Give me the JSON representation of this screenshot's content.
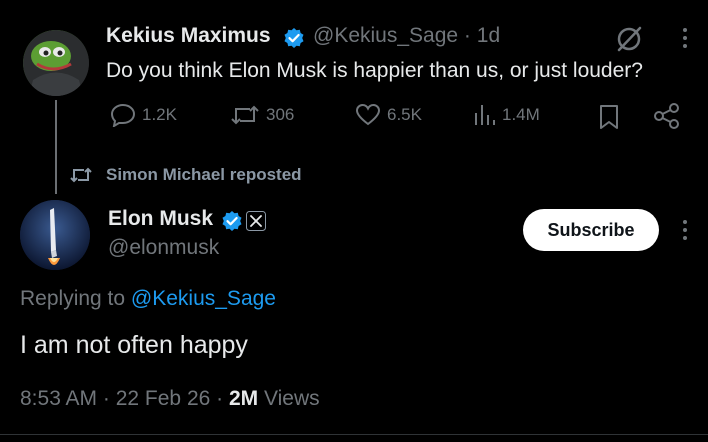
{
  "quoted_tweet": {
    "author_name": "Kekius Maximus",
    "handle": "@Kekius_Sage",
    "separator": "·",
    "time_ago": "1d",
    "text": "Do you think Elon Musk is happier than us, or just louder?",
    "metrics": {
      "replies": "1.2K",
      "reposts": "306",
      "likes": "6.5K",
      "views": "1.4M"
    }
  },
  "repost_label": "Simon Michael reposted",
  "main_tweet": {
    "author_name": "Elon Musk",
    "handle": "@elonmusk",
    "subscribe_label": "Subscribe",
    "replying_prefix": "Replying to",
    "replying_handle": "@Kekius_Sage",
    "text": "I am not often happy",
    "time": "8:53 AM",
    "date": "22 Feb 26",
    "views_count": "2M",
    "views_label": "Views"
  },
  "colors": {
    "background": "#000000",
    "primary_text": "#e7e9ea",
    "secondary_text": "#71767b",
    "link_blue": "#1d9bf0",
    "verified_blue": "#1d9bf0"
  }
}
